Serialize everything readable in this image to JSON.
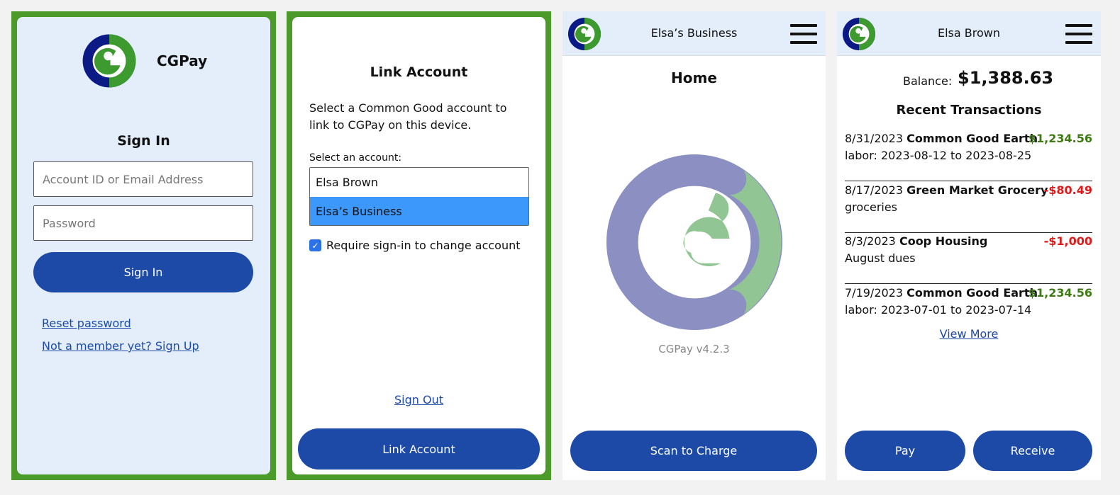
{
  "colors": {
    "frame_green": "#4c9a2a",
    "brand_blue": "#1c4aa6",
    "light_blue": "#e3eefa",
    "positive": "#3d7a14",
    "negative": "#e01818"
  },
  "signin": {
    "brand": "CGPay",
    "title": "Sign In",
    "account_placeholder": "Account ID or Email Address",
    "password_placeholder": "Password",
    "signin_button": "Sign In",
    "reset_link": "Reset password",
    "signup_link": "Not a member yet? Sign Up"
  },
  "link_account": {
    "title": "Link Account",
    "description": "Select a Common Good account to link to CGPay on this device.",
    "select_label": "Select an account:",
    "options": [
      "Elsa Brown",
      "Elsa’s Business"
    ],
    "selected_option": "Elsa’s Business",
    "checkbox_label": "Require sign-in to change account",
    "checkbox_checked": true,
    "signout_link": "Sign Out",
    "link_button": "Link Account"
  },
  "home": {
    "header_title": "Elsa’s Business",
    "title": "Home",
    "version": "CGPay v4.2.3",
    "scan_button": "Scan to Charge"
  },
  "account": {
    "header_title": "Elsa Brown",
    "balance_label": "Balance:",
    "balance_value": "$1,388.63",
    "recent_title": "Recent Transactions",
    "transactions": [
      {
        "date": "8/31/2023",
        "party": "Common Good Earth",
        "amount": "$1,234.56",
        "desc": "labor: 2023-08-12 to 2023-08-25"
      },
      {
        "date": "8/17/2023",
        "party": "Green Market Grocery",
        "amount": "-$80.49",
        "desc": "groceries"
      },
      {
        "date": "8/3/2023",
        "party": "Coop Housing",
        "amount": "-$1,000",
        "desc": "August dues"
      },
      {
        "date": "7/19/2023",
        "party": "Common Good Earth",
        "amount": "$1,234.56",
        "desc": "labor: 2023-07-01 to 2023-07-14"
      }
    ],
    "view_more": "View More",
    "pay_button": "Pay",
    "receive_button": "Receive"
  },
  "icons": [
    "cg-logo-icon",
    "hamburger-menu-icon",
    "checkbox-checked-icon"
  ]
}
